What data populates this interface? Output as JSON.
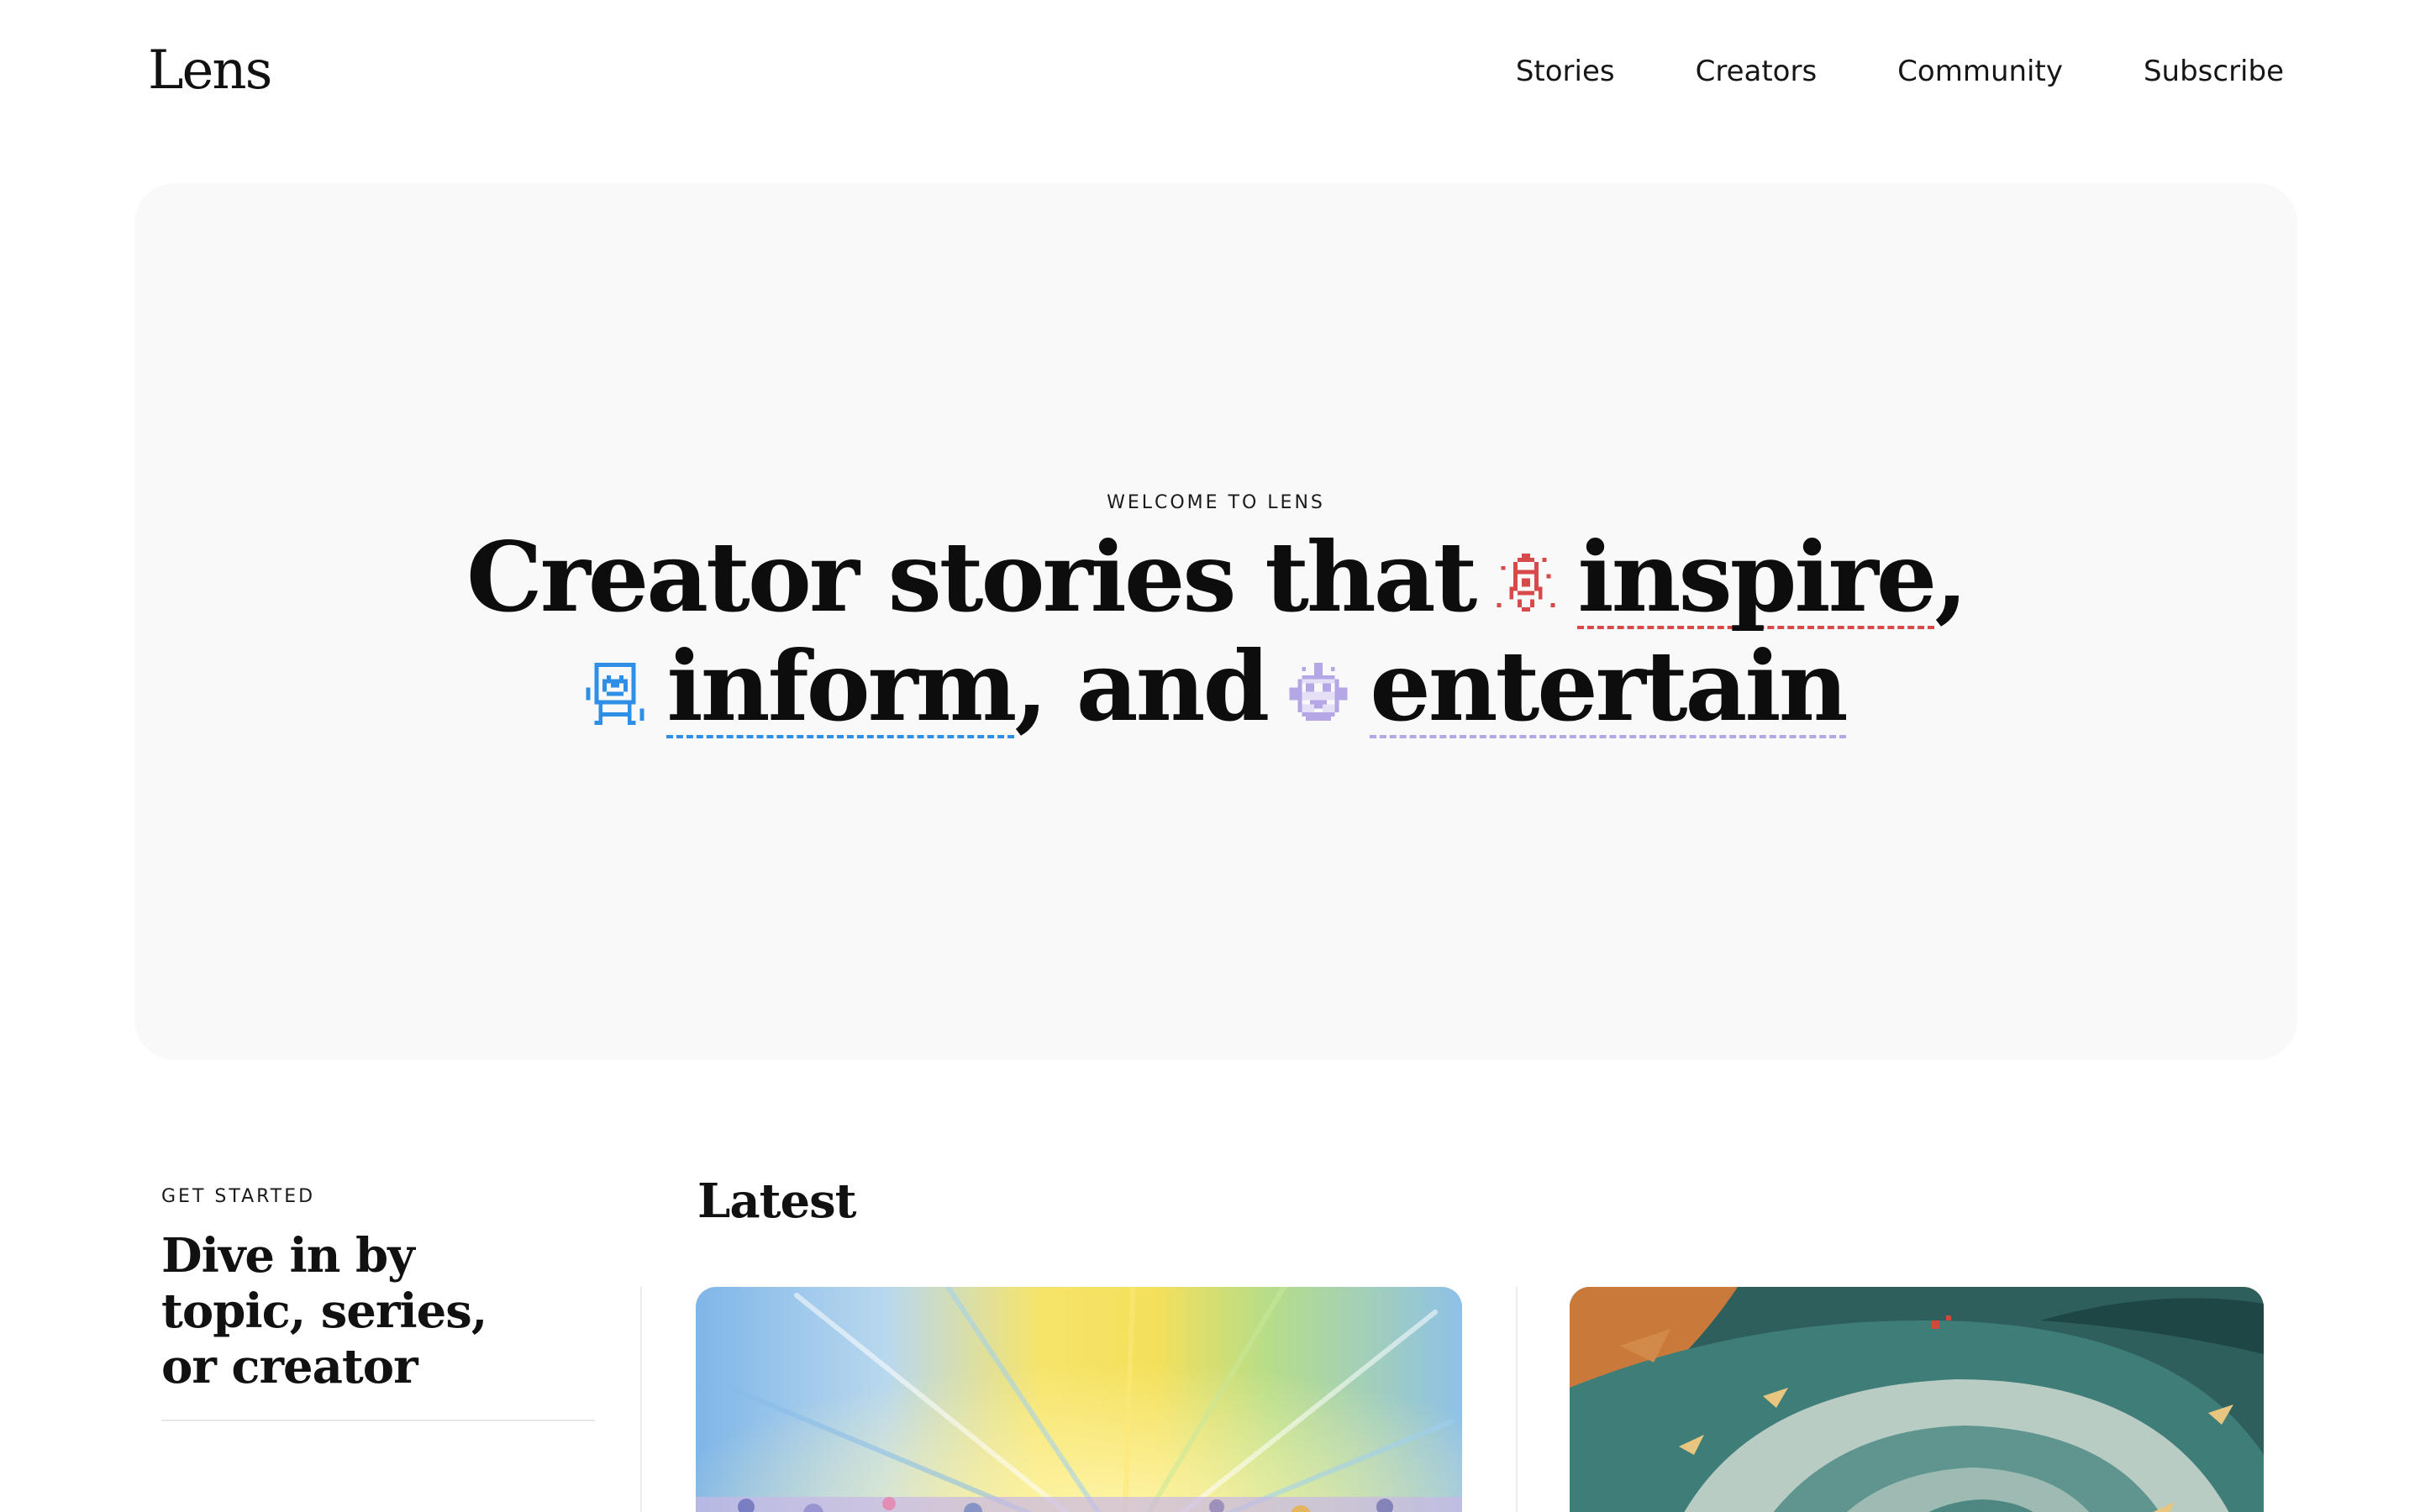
{
  "header": {
    "logo_text": "Lens",
    "nav": [
      {
        "label": "Stories"
      },
      {
        "label": "Creators"
      },
      {
        "label": "Community"
      },
      {
        "label": "Subscribe"
      }
    ]
  },
  "hero": {
    "eyebrow": "WELCOME TO LENS",
    "line1_start": "Creator stories that",
    "kw1": "inspire",
    "kw1_suffix": ",",
    "kw2": "inform",
    "kw2_suffix": ", and",
    "kw3": "entertain",
    "icons": [
      "rocket-icon",
      "easel-icon",
      "robot-icon"
    ],
    "colors": {
      "inspire": "#d84a4a",
      "inform": "#2f8fe6",
      "entertain": "#b5a6e6"
    }
  },
  "get_started": {
    "eyebrow": "GET STARTED",
    "title": "Dive in by topic, series, or creator"
  },
  "latest": {
    "title": "Latest"
  }
}
